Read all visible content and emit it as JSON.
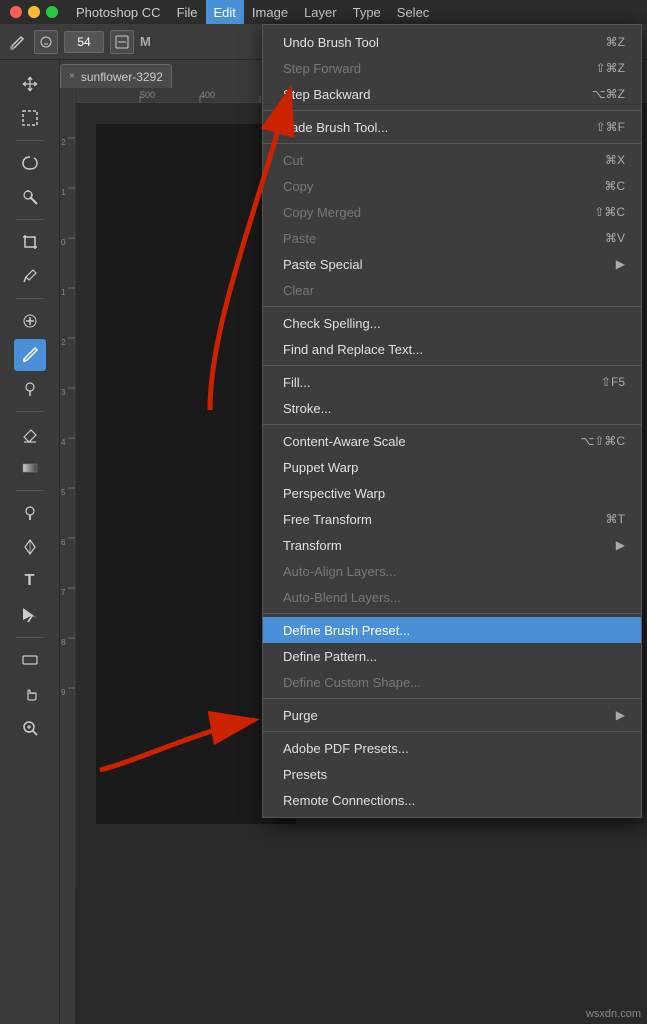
{
  "app": {
    "title": "Photoshop CC",
    "traffic_lights": [
      "close",
      "minimize",
      "maximize"
    ]
  },
  "menubar": {
    "items": [
      {
        "label": "Photoshop CC",
        "active": false
      },
      {
        "label": "File",
        "active": false
      },
      {
        "label": "Edit",
        "active": true
      },
      {
        "label": "Image",
        "active": false
      },
      {
        "label": "Layer",
        "active": false
      },
      {
        "label": "Type",
        "active": false
      },
      {
        "label": "Selec",
        "active": false
      }
    ]
  },
  "options_bar": {
    "brush_size": "54"
  },
  "tab": {
    "name": "sunflower-3292",
    "close_label": "×"
  },
  "ruler": {
    "h_marks": [
      "500",
      "400"
    ],
    "v_marks": [
      "2",
      "1",
      "0",
      "1",
      "2",
      "3",
      "4",
      "5",
      "6",
      "7",
      "8",
      "9"
    ]
  },
  "toolbar": {
    "tools": [
      {
        "id": "move",
        "icon": "✥",
        "active": false
      },
      {
        "id": "marquee",
        "icon": "⬜",
        "active": false
      },
      {
        "id": "lasso",
        "icon": "⬭",
        "active": false
      },
      {
        "id": "magic-wand",
        "icon": "✦",
        "active": false
      },
      {
        "id": "crop",
        "icon": "⊡",
        "active": false
      },
      {
        "id": "eyedropper",
        "icon": "💉",
        "active": false
      },
      {
        "id": "healing",
        "icon": "✚",
        "active": false
      },
      {
        "id": "brush",
        "icon": "🖌",
        "active": true
      },
      {
        "id": "clone",
        "icon": "✎",
        "active": false
      },
      {
        "id": "eraser",
        "icon": "◻",
        "active": false
      },
      {
        "id": "gradient",
        "icon": "▤",
        "active": false
      },
      {
        "id": "dodge",
        "icon": "◯",
        "active": false
      },
      {
        "id": "pen",
        "icon": "✒",
        "active": false
      },
      {
        "id": "text",
        "icon": "T",
        "active": false
      },
      {
        "id": "path-select",
        "icon": "↖",
        "active": false
      },
      {
        "id": "shape",
        "icon": "▭",
        "active": false
      },
      {
        "id": "hand",
        "icon": "✋",
        "active": false
      },
      {
        "id": "zoom",
        "icon": "🔍",
        "active": false
      }
    ]
  },
  "edit_menu": {
    "items": [
      {
        "id": "undo-brush",
        "label": "Undo Brush Tool",
        "shortcut": "⌘Z",
        "disabled": false,
        "has_arrow": false,
        "highlighted": false,
        "separator_after": false
      },
      {
        "id": "step-forward",
        "label": "Step Forward",
        "shortcut": "⇧⌘Z",
        "disabled": true,
        "has_arrow": false,
        "highlighted": false,
        "separator_after": false
      },
      {
        "id": "step-backward",
        "label": "Step Backward",
        "shortcut": "⌥⌘Z",
        "disabled": false,
        "has_arrow": false,
        "highlighted": false,
        "separator_after": true
      },
      {
        "id": "fade-brush",
        "label": "Fade Brush Tool...",
        "shortcut": "⇧⌘F",
        "disabled": false,
        "has_arrow": false,
        "highlighted": false,
        "separator_after": true
      },
      {
        "id": "cut",
        "label": "Cut",
        "shortcut": "⌘X",
        "disabled": true,
        "has_arrow": false,
        "highlighted": false,
        "separator_after": false
      },
      {
        "id": "copy",
        "label": "Copy",
        "shortcut": "⌘C",
        "disabled": true,
        "has_arrow": false,
        "highlighted": false,
        "separator_after": false
      },
      {
        "id": "copy-merged",
        "label": "Copy Merged",
        "shortcut": "⇧⌘C",
        "disabled": true,
        "has_arrow": false,
        "highlighted": false,
        "separator_after": false
      },
      {
        "id": "paste",
        "label": "Paste",
        "shortcut": "⌘V",
        "disabled": true,
        "has_arrow": false,
        "highlighted": false,
        "separator_after": false
      },
      {
        "id": "paste-special",
        "label": "Paste Special",
        "shortcut": "",
        "disabled": false,
        "has_arrow": true,
        "highlighted": false,
        "separator_after": false
      },
      {
        "id": "clear",
        "label": "Clear",
        "shortcut": "",
        "disabled": true,
        "has_arrow": false,
        "highlighted": false,
        "separator_after": true
      },
      {
        "id": "check-spelling",
        "label": "Check Spelling...",
        "shortcut": "",
        "disabled": false,
        "has_arrow": false,
        "highlighted": false,
        "separator_after": false
      },
      {
        "id": "find-replace",
        "label": "Find and Replace Text...",
        "shortcut": "",
        "disabled": false,
        "has_arrow": false,
        "highlighted": false,
        "separator_after": true
      },
      {
        "id": "fill",
        "label": "Fill...",
        "shortcut": "⇧F5",
        "disabled": false,
        "has_arrow": false,
        "highlighted": false,
        "separator_after": false
      },
      {
        "id": "stroke",
        "label": "Stroke...",
        "shortcut": "",
        "disabled": false,
        "has_arrow": false,
        "highlighted": false,
        "separator_after": true
      },
      {
        "id": "content-aware-scale",
        "label": "Content-Aware Scale",
        "shortcut": "⌥⇧⌘C",
        "disabled": false,
        "has_arrow": false,
        "highlighted": false,
        "separator_after": false
      },
      {
        "id": "puppet-warp",
        "label": "Puppet Warp",
        "shortcut": "",
        "disabled": false,
        "has_arrow": false,
        "highlighted": false,
        "separator_after": false
      },
      {
        "id": "perspective-warp",
        "label": "Perspective Warp",
        "shortcut": "",
        "disabled": false,
        "has_arrow": false,
        "highlighted": false,
        "separator_after": false
      },
      {
        "id": "free-transform",
        "label": "Free Transform",
        "shortcut": "⌘T",
        "disabled": false,
        "has_arrow": false,
        "highlighted": false,
        "separator_after": false
      },
      {
        "id": "transform",
        "label": "Transform",
        "shortcut": "",
        "disabled": false,
        "has_arrow": true,
        "highlighted": false,
        "separator_after": false
      },
      {
        "id": "auto-align",
        "label": "Auto-Align Layers...",
        "shortcut": "",
        "disabled": true,
        "has_arrow": false,
        "highlighted": false,
        "separator_after": false
      },
      {
        "id": "auto-blend",
        "label": "Auto-Blend Layers...",
        "shortcut": "",
        "disabled": true,
        "has_arrow": false,
        "highlighted": false,
        "separator_after": true
      },
      {
        "id": "define-brush-preset",
        "label": "Define Brush Preset...",
        "shortcut": "",
        "disabled": false,
        "has_arrow": false,
        "highlighted": true,
        "separator_after": false
      },
      {
        "id": "define-pattern",
        "label": "Define Pattern...",
        "shortcut": "",
        "disabled": false,
        "has_arrow": false,
        "highlighted": false,
        "separator_after": false
      },
      {
        "id": "define-custom-shape",
        "label": "Define Custom Shape...",
        "shortcut": "",
        "disabled": true,
        "has_arrow": false,
        "highlighted": false,
        "separator_after": true
      },
      {
        "id": "purge",
        "label": "Purge",
        "shortcut": "",
        "disabled": false,
        "has_arrow": true,
        "highlighted": false,
        "separator_after": true
      },
      {
        "id": "adobe-pdf-presets",
        "label": "Adobe PDF Presets...",
        "shortcut": "",
        "disabled": false,
        "has_arrow": false,
        "highlighted": false,
        "separator_after": false
      },
      {
        "id": "presets",
        "label": "Presets",
        "shortcut": "",
        "disabled": false,
        "has_arrow": false,
        "highlighted": false,
        "separator_after": false
      },
      {
        "id": "remote-connections",
        "label": "Remote Connections...",
        "shortcut": "",
        "disabled": false,
        "has_arrow": false,
        "highlighted": false,
        "separator_after": false
      }
    ]
  },
  "watermark": "wsxdn.com"
}
